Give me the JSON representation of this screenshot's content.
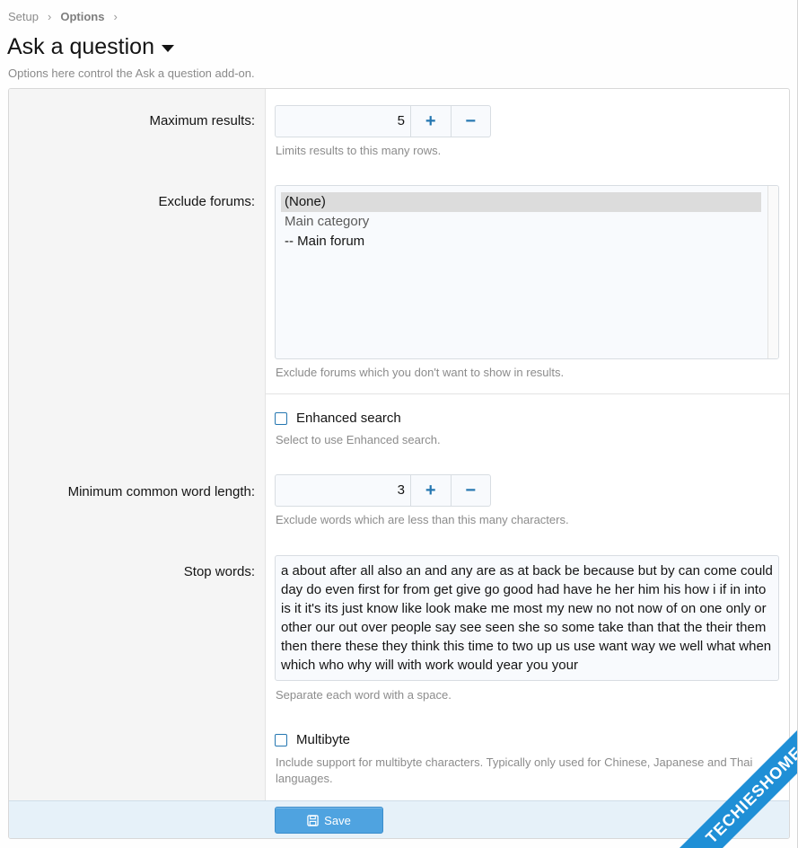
{
  "breadcrumb": [
    {
      "label": "Setup"
    },
    {
      "label": "Options"
    }
  ],
  "page": {
    "title": "Ask a question",
    "description": "Options here control the Ask a question add-on."
  },
  "options": {
    "max_results": {
      "label": "Maximum results:",
      "value": "5",
      "hint": "Limits results to this many rows."
    },
    "exclude_forums": {
      "label": "Exclude forums:",
      "options": [
        "(None)",
        "Main category",
        "-- Main forum"
      ],
      "selected": "(None)",
      "hint": "Exclude forums which you don't want to show in results."
    },
    "enhanced_search": {
      "label": "Enhanced search",
      "checked": false,
      "hint": "Select to use Enhanced search."
    },
    "min_word_length": {
      "label": "Minimum common word length:",
      "value": "3",
      "hint": "Exclude words which are less than this many characters."
    },
    "stop_words": {
      "label": "Stop words:",
      "value": "a about after all also an and any are as at back be because but by can come could day do even first for from get give go good had have he her him his how i if in into is it it's its just know like look make me most my new no not now of on one only or other our out over people say see seen she so some take than that the their them then there these they think this time to two up us use want way we well what when which who why will with work would year you your",
      "hint": "Separate each word with a space."
    },
    "multibyte": {
      "label": "Multibyte",
      "checked": false,
      "hint_line1": "Include support for multibyte characters. Typically only used for Chinese, Japanese and Thai",
      "hint_line2": "languages."
    }
  },
  "stepper": {
    "plus": "+",
    "minus": "−"
  },
  "footer": {
    "save_label": "Save"
  },
  "watermark": {
    "text": "TECHIESHOME.COM"
  },
  "colors": {
    "accent": "#2577b1",
    "button": "#4fa3e0",
    "footer_bg": "#e6f1f9"
  }
}
